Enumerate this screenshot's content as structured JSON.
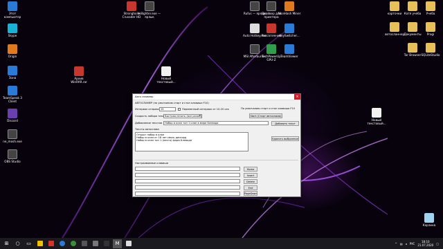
{
  "desktop": {
    "icons": [
      {
        "id": "shortcut-this-pc",
        "label": "Этот компьютер",
        "color": "#2a7bd8",
        "kind": "blue"
      },
      {
        "id": "shortcut-skype",
        "label": "Skype",
        "color": "#1ab1d6",
        "kind": "cyan"
      },
      {
        "id": "shortcut-origin",
        "label": "Origin",
        "color": "#e07a1e",
        "kind": "orange"
      },
      {
        "id": "shortcut-zona",
        "label": "Зона",
        "color": "#2a7bd8",
        "kind": "blue"
      },
      {
        "id": "shortcut-teamspeak",
        "label": "TeamSpeak 3 Client",
        "color": "#2a7bd8",
        "kind": "blue"
      },
      {
        "id": "shortcut-discord",
        "label": "Discord",
        "color": "#6a3fb0",
        "kind": "purple"
      },
      {
        "id": "shortcut-ne-mosh",
        "label": "ne_mosh.exe",
        "color": "#444",
        "kind": "dark"
      },
      {
        "id": "shortcut-obs",
        "label": "OBS Studio",
        "color": "#444",
        "kind": "dark"
      },
      {
        "id": "shortcut-stronghold",
        "label": "Stronghold Crusader HD",
        "color": "#c8372d",
        "kind": "red"
      },
      {
        "id": "shortcut-w8ighter",
        "label": "w8ighter.exe — ярлык",
        "color": "#444",
        "kind": "dark"
      },
      {
        "id": "shortcut-winrar",
        "label": "Архив WinRAR.rar",
        "color": "#c8372d",
        "kind": "red"
      },
      {
        "id": "shortcut-new-text",
        "label": "Новый текстовый...",
        "color": "#f2f2f2",
        "kind": "doc"
      },
      {
        "id": "shortcut-rufus",
        "label": "Rufus — ярлык",
        "color": "#444",
        "kind": "dark"
      },
      {
        "id": "shortcut-driver",
        "label": "Драйвер для принтера",
        "color": "#444",
        "kind": "dark"
      },
      {
        "id": "shortcut-nicehash",
        "label": "NiceHash Miner",
        "color": "#e07a1e",
        "kind": "orange"
      },
      {
        "id": "shortcut-auto-hotkey",
        "label": "Auto Hotkey.exe",
        "color": "#ddd",
        "kind": "white"
      },
      {
        "id": "shortcut-rosstorrent",
        "label": "Росcопление",
        "color": "#c8372d",
        "kind": "red"
      },
      {
        "id": "shortcut-keysw",
        "label": "KeySwitcher...",
        "color": "#2a7bd8",
        "kind": "blue"
      },
      {
        "id": "shortcut-msi",
        "label": "MSI Afterburner",
        "color": "#444",
        "kind": "dark"
      },
      {
        "id": "shortcut-techpowerup",
        "label": "TechPowerUp GPU-Z",
        "color": "#2f9e4a",
        "kind": "green"
      },
      {
        "id": "shortcut-teamviewer",
        "label": "TeamViewer",
        "color": "#2a7bd8",
        "kind": "blue"
      },
      {
        "id": "shortcut-kartochki",
        "label": "карточки",
        "color": "#e8c05a",
        "kind": "folder"
      },
      {
        "id": "shortcut-katya",
        "label": "Катя учеба",
        "color": "#e8c05a",
        "kind": "folder"
      },
      {
        "id": "shortcut-ucheba",
        "label": "Учеба",
        "color": "#e8c05a",
        "kind": "folder"
      },
      {
        "id": "shortcut-avtoslanner",
        "label": "автосланнер",
        "color": "#e8c05a",
        "kind": "folder"
      },
      {
        "id": "shortcut-documents",
        "label": "Документы",
        "color": "#e8c05a",
        "kind": "folder"
      },
      {
        "id": "shortcut-progi",
        "label": "Progi",
        "color": "#e8c05a",
        "kind": "folder"
      },
      {
        "id": "shortcut-tor",
        "label": "Tor Browser",
        "color": "#e8c05a",
        "kind": "folder"
      },
      {
        "id": "shortcut-sqlite",
        "label": "SQLiteStudio",
        "color": "#e8c05a",
        "kind": "folder"
      },
      {
        "id": "shortcut-new-text-2",
        "label": "Новый текстовый...",
        "color": "#f2f2f2",
        "kind": "doc"
      },
      {
        "id": "shortcut-recycle",
        "label": "Корзина",
        "color": "#9fd3f0",
        "kind": "bin"
      }
    ]
  },
  "dialog": {
    "title": "Авто спаммер",
    "autosend_note": "АВТОСПАМЕР (по умолчанию старт и стоп клавиша F10)",
    "interval_label": "Интервал отправки",
    "interval_value": "15",
    "random_interval_label": "Переменный интервал от 10-20 сек",
    "hotkey_note": "По умолчанию старт и стоп клавиша F10",
    "speed_label": "Скорость набора текста",
    "speed_value": "Быстрая печать (все разом)",
    "start_button": "Start (Старт автоспама)",
    "add_text_label": "Добавление текстов",
    "add_text_value": "Набор в клан топ 1 клан в мире Блевода",
    "add_text_button": "Добавить текст",
    "texts_label": "Тексты автоспама",
    "texts": [
      "Открыт набор в клан",
      "Набор в клан от 18 лет связь дискорд",
      "Набор в клан топ 1 (место) фарм Блевода"
    ],
    "delete_button": "Удалить выбранное",
    "macros_label": "Настраиваемые клавиши",
    "macro_buttons": [
      "Home",
      "Insert",
      "Delete",
      "End",
      "PageUp",
      "PageDown"
    ]
  },
  "taskbar": {
    "start_icon": "windows-icon",
    "apps": [
      "search-icon",
      "task-view-icon",
      "yandex-icon",
      "explorer-icon",
      "telegram-icon",
      "chrome-icon",
      "steam-icon",
      "app-icon",
      "app-icon",
      "m-icon",
      "app-icon"
    ],
    "tray_lang": "РУС",
    "time": "18:10",
    "date": "21.07.2020"
  }
}
